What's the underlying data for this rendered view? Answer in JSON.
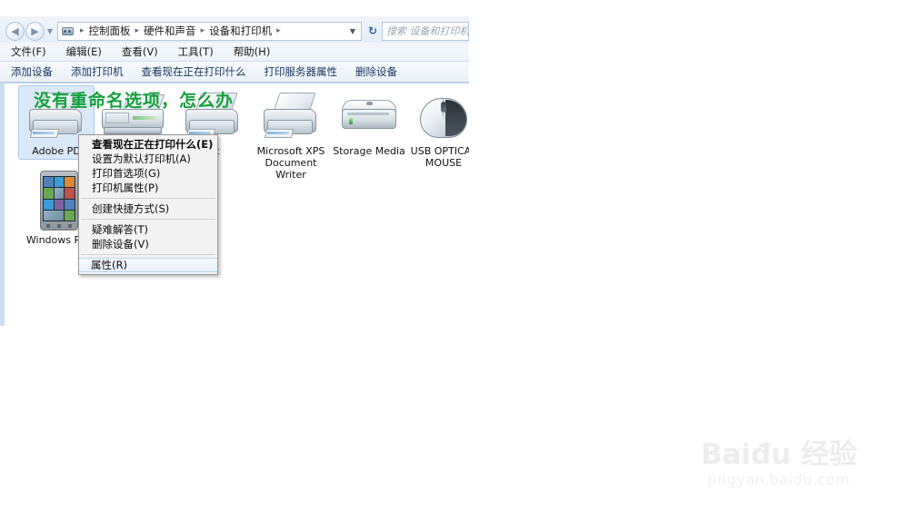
{
  "window": {
    "nav": {
      "back_label": "◀",
      "forward_label": "▶",
      "history_caret": "▼",
      "refresh_label": "↻"
    },
    "address": {
      "icon": "control-panel-icon",
      "breadcrumbs": [
        "控制面板",
        "硬件和声音",
        "设备和打印机"
      ],
      "separator": "▸",
      "dropdown_caret": "▼"
    },
    "search": {
      "placeholder": "搜索 设备和打印机"
    },
    "menubar": [
      {
        "label": "文件(F)"
      },
      {
        "label": "编辑(E)"
      },
      {
        "label": "查看(V)"
      },
      {
        "label": "工具(T)"
      },
      {
        "label": "帮助(H)"
      }
    ],
    "commandbar": [
      {
        "label": "添加设备"
      },
      {
        "label": "添加打印机"
      },
      {
        "label": "查看现在正在打印什么"
      },
      {
        "label": "打印服务器属性"
      },
      {
        "label": "删除设备"
      }
    ],
    "devices": [
      {
        "name": "Adobe PD",
        "icon": "printer-icon",
        "selected": true
      },
      {
        "name": "",
        "icon": "fax-icon",
        "selected": false
      },
      {
        "name": "oft",
        "icon": "printer-icon",
        "selected": false
      },
      {
        "name": "Microsoft XPS Document Writer",
        "icon": "printer-icon",
        "selected": false
      },
      {
        "name": "Storage Media",
        "icon": "storage-media-icon",
        "selected": false
      },
      {
        "name": "USB OPTICAL MOUSE",
        "icon": "mouse-icon",
        "selected": false
      },
      {
        "name": "Windows Ph",
        "icon": "windows-phone-icon",
        "selected": false
      }
    ]
  },
  "annotation": {
    "text": "没有重命名选项，怎么办",
    "color": "#14a03c"
  },
  "context_menu": {
    "items": [
      {
        "label": "查看现在正在打印什么(E)",
        "bold": true,
        "separator_after": false
      },
      {
        "label": "设置为默认打印机(A)",
        "bold": false,
        "separator_after": false
      },
      {
        "label": "打印首选项(G)",
        "bold": false,
        "separator_after": false
      },
      {
        "label": "打印机属性(P)",
        "bold": false,
        "separator_after": true
      },
      {
        "label": "创建快捷方式(S)",
        "bold": false,
        "separator_after": true
      },
      {
        "label": "疑难解答(T)",
        "bold": false,
        "separator_after": false
      },
      {
        "label": "删除设备(V)",
        "bold": false,
        "separator_after": true
      },
      {
        "label": "属性(R)",
        "bold": false,
        "hover": true,
        "separator_after": false
      }
    ]
  },
  "watermark": {
    "top": "Baiđu 经验",
    "bottom": "jingyan.baidu.com"
  }
}
